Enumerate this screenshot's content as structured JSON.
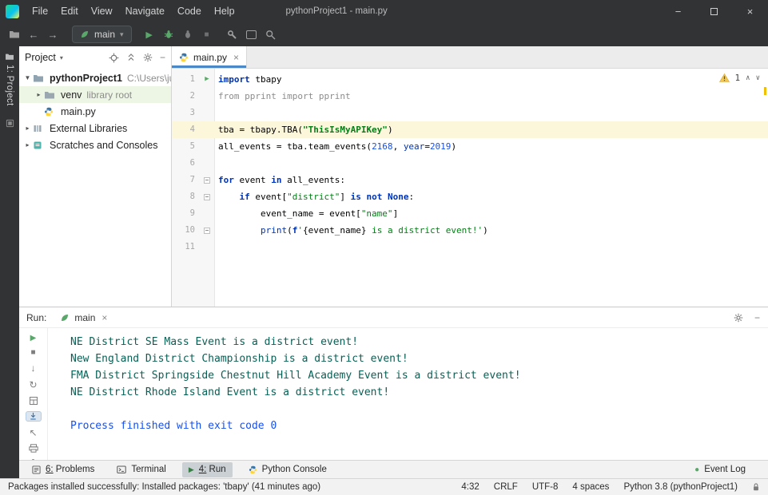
{
  "colors": {
    "kw": "#0033B3",
    "str": "#067D17",
    "num": "#1750EB",
    "plain": "#000000",
    "gray": "#8C8C8C",
    "builtin": "#0033B3",
    "stdout": "#0A6055",
    "system": "#1750EB",
    "accent_green": "#59A869",
    "warning": "#F0C000",
    "current_line": "#FCF6DB",
    "selection": "#EDF5E4",
    "tab_underline": "#4A88C7"
  },
  "icons": {
    "back": "←",
    "forward": "→",
    "run": "▶",
    "stop": "■",
    "chevron_down": "▾",
    "chevron_right": "▸",
    "expand": "▼",
    "close": "×",
    "minimize": "−",
    "nav_up": "∧",
    "nav_down": "∨",
    "down": "↓",
    "restart": "↻",
    "up_left": "↖",
    "event_dot": "●"
  },
  "window": {
    "title": "pythonProject1 - main.py",
    "menus": [
      "File",
      "Edit",
      "View",
      "Navigate",
      "Code",
      "Help"
    ]
  },
  "toolbar": {
    "run_config": "main"
  },
  "left_strip": {
    "project_label": "1: Project"
  },
  "project": {
    "header": "Project",
    "tree": [
      {
        "icon": "project-folder",
        "name": "pythonProject1",
        "detail": "C:\\Users\\ju",
        "bold": true,
        "chevron": "down",
        "indent": 0,
        "selected": false
      },
      {
        "icon": "folder",
        "name": "venv",
        "detail": "library root",
        "bold": false,
        "chevron": "right",
        "indent": 1,
        "selected": true
      },
      {
        "icon": "python-file",
        "name": "main.py",
        "detail": "",
        "bold": false,
        "chevron": "",
        "indent": 1,
        "selected": false
      },
      {
        "icon": "libraries",
        "name": "External Libraries",
        "detail": "",
        "bold": false,
        "chevron": "right",
        "indent": 0,
        "selected": false
      },
      {
        "icon": "scratches",
        "name": "Scratches and Consoles",
        "detail": "",
        "bold": false,
        "chevron": "right",
        "indent": 0,
        "selected": false
      }
    ]
  },
  "editor": {
    "tab": "main.py",
    "warning_count": "1",
    "lines": [
      {
        "n": "1",
        "run": true,
        "tokens": [
          [
            "k",
            "import"
          ],
          [
            "p",
            " tbapy"
          ]
        ]
      },
      {
        "n": "2",
        "tokens": [
          [
            "g",
            "from pprint import pprint"
          ]
        ]
      },
      {
        "n": "3",
        "tokens": []
      },
      {
        "n": "4",
        "current": true,
        "tokens": [
          [
            "p",
            "tba = tbapy.TBA("
          ],
          [
            "sb",
            "\"ThisIsMyAPIKey\""
          ],
          [
            "p",
            ")"
          ]
        ]
      },
      {
        "n": "5",
        "tokens": [
          [
            "p",
            "all_events = tba.team_events("
          ],
          [
            "num",
            "2168"
          ],
          [
            "p",
            ", "
          ],
          [
            "na",
            "year"
          ],
          [
            "p",
            "="
          ],
          [
            "num",
            "2019"
          ],
          [
            "p",
            ")"
          ]
        ]
      },
      {
        "n": "6",
        "tokens": []
      },
      {
        "n": "7",
        "fold": true,
        "tokens": [
          [
            "k",
            "for"
          ],
          [
            "p",
            " event "
          ],
          [
            "k",
            "in"
          ],
          [
            "p",
            " all_events:"
          ]
        ]
      },
      {
        "n": "8",
        "fold": true,
        "tokens": [
          [
            "p",
            "    "
          ],
          [
            "k",
            "if"
          ],
          [
            "p",
            " event["
          ],
          [
            "s",
            "\"district\""
          ],
          [
            "p",
            "] "
          ],
          [
            "k",
            "is"
          ],
          [
            "p",
            " "
          ],
          [
            "k",
            "not"
          ],
          [
            "p",
            " "
          ],
          [
            "k",
            "None"
          ],
          [
            "p",
            ":"
          ]
        ]
      },
      {
        "n": "9",
        "tokens": [
          [
            "p",
            "        event_name = event["
          ],
          [
            "s",
            "\"name\""
          ],
          [
            "p",
            "]"
          ]
        ]
      },
      {
        "n": "10",
        "fold": true,
        "tokens": [
          [
            "p",
            "        "
          ],
          [
            "b",
            "print"
          ],
          [
            "p",
            "("
          ],
          [
            "k",
            "f"
          ],
          [
            "s",
            "'"
          ],
          [
            "fx",
            "{event_name}"
          ],
          [
            "s",
            " is a district event!'"
          ],
          [
            "p",
            ")"
          ]
        ]
      },
      {
        "n": "11",
        "tokens": []
      }
    ]
  },
  "run": {
    "label": "Run:",
    "tab": "main",
    "stdout": [
      "NE District SE Mass Event is a district event!",
      "New England District Championship is a district event!",
      "FMA District Springside Chestnut Hill Academy Event is a district event!",
      "NE District Rhode Island Event is a district event!"
    ],
    "system": "Process finished with exit code 0"
  },
  "bottom": {
    "problems": "6: Problems",
    "terminal": "Terminal",
    "run": "4: Run",
    "python_console": "Python Console",
    "event_log": "Event Log"
  },
  "status": {
    "message": "Packages installed successfully: Installed packages: 'tbapy' (41 minutes ago)",
    "caret": "4:32",
    "line_ending": "CRLF",
    "encoding": "UTF-8",
    "indent": "4 spaces",
    "interpreter": "Python 3.8 (pythonProject1)"
  }
}
